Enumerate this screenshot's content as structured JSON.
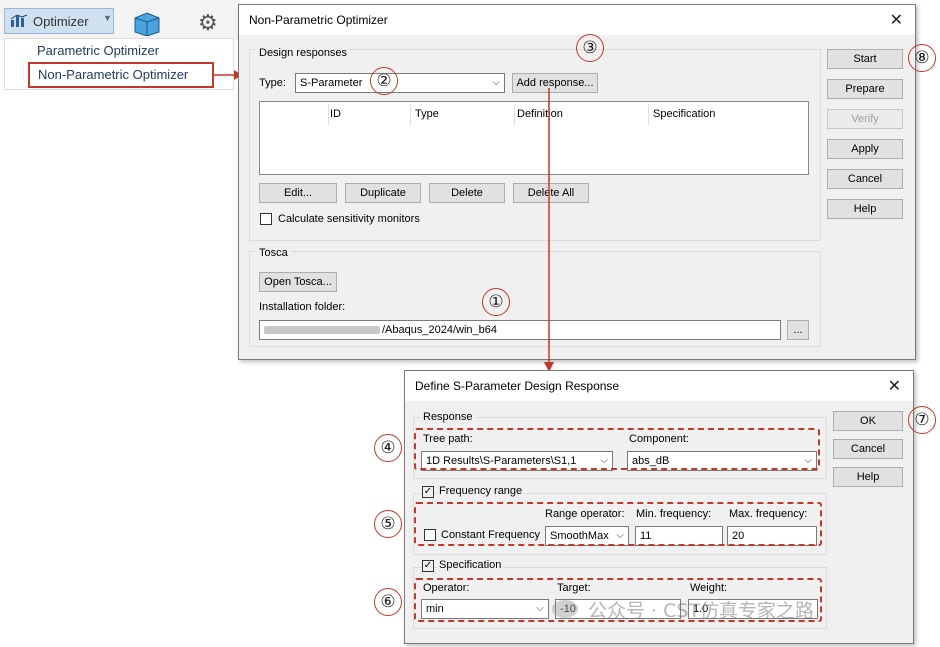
{
  "toolbar": {
    "optimizer_label": "Optimizer",
    "menu": [
      "Parametric Optimizer",
      "Non-Parametric Optimizer"
    ]
  },
  "npo": {
    "title": "Non-Parametric Optimizer",
    "design_responses_label": "Design responses",
    "type_label": "Type:",
    "type_value": "S-Parameter",
    "add_response": "Add response...",
    "columns": [
      "ID",
      "Type",
      "Definition",
      "Specification"
    ],
    "edit": "Edit...",
    "duplicate": "Duplicate",
    "delete": "Delete",
    "delete_all": "Delete All",
    "sensitivity": "Calculate sensitivity monitors",
    "tosca_label": "Tosca",
    "open_tosca": "Open Tosca...",
    "install_label": "Installation folder:",
    "install_path": "/Abaqus_2024/win_b64",
    "browse": "...",
    "side_buttons": {
      "start": "Start",
      "prepare": "Prepare",
      "verify": "Verify",
      "apply": "Apply",
      "cancel": "Cancel",
      "help": "Help"
    }
  },
  "dsp": {
    "title": "Define S-Parameter Design Response",
    "response_label": "Response",
    "tree_path_label": "Tree path:",
    "tree_path_value": "1D Results\\S-Parameters\\S1,1",
    "component_label": "Component:",
    "component_value": "abs_dB",
    "frequency_range_label": "Frequency range",
    "constant_frequency": "Constant Frequency",
    "range_operator_label": "Range operator:",
    "range_operator_value": "SmoothMax",
    "min_freq_label": "Min. frequency:",
    "min_freq_value": "11",
    "max_freq_label": "Max. frequency:",
    "max_freq_value": "20",
    "specification_label": "Specification",
    "operator_label": "Operator:",
    "operator_value": "min",
    "target_label": "Target:",
    "target_value": "-10",
    "weight_label": "Weight:",
    "weight_value": "1.0",
    "ok": "OK",
    "cancel": "Cancel",
    "help": "Help"
  },
  "callouts": [
    "①",
    "②",
    "③",
    "④",
    "⑤",
    "⑥",
    "⑦",
    "⑧"
  ],
  "watermark": "公众号 · CST仿真专家之路",
  "colors": {
    "annotation": "#c0392b",
    "dialog_bg": "#f0f0f0"
  }
}
